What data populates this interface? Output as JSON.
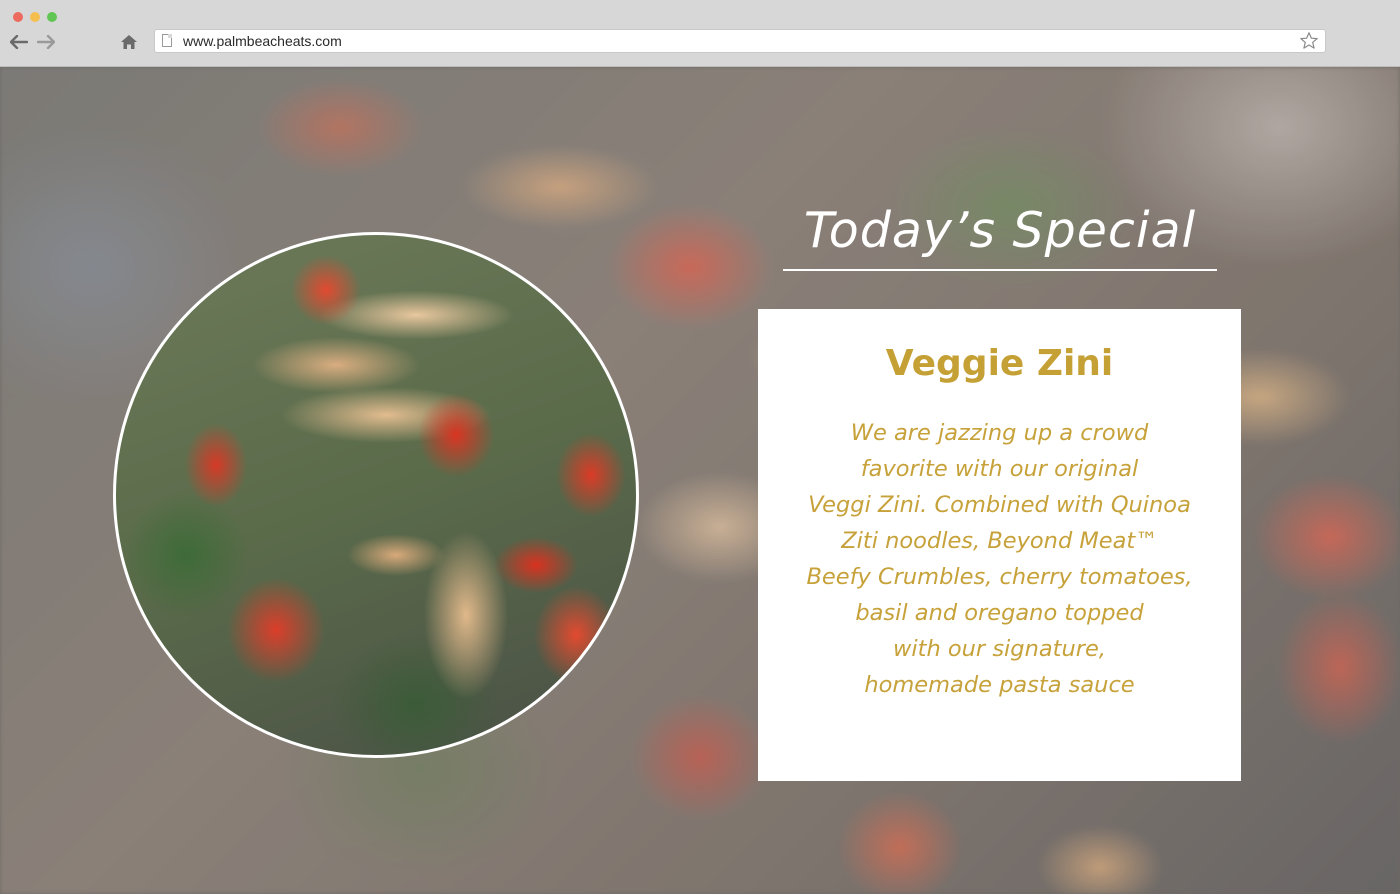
{
  "browser": {
    "url": "www.palmbeacheats.com",
    "icons": [
      "back-arrow-icon",
      "forward-arrow-icon",
      "home-icon",
      "page-icon",
      "star-icon"
    ]
  },
  "special": {
    "heading": "Today’s Special",
    "dish_name": "Veggie Zini",
    "description_lines": [
      "We are jazzing up a crowd",
      "favorite with our original",
      "Veggi Zini. Combined with Quinoa",
      "Ziti noodles, Beyond Meat™",
      "Beefy Crumbles, cherry tomatoes,",
      "basil and oregano topped",
      "with our signature,",
      "homemade pasta sauce"
    ]
  },
  "colors": {
    "accent_gold": "#c4a035",
    "chrome_bg": "#d7d7d7",
    "card_bg": "#ffffff"
  }
}
